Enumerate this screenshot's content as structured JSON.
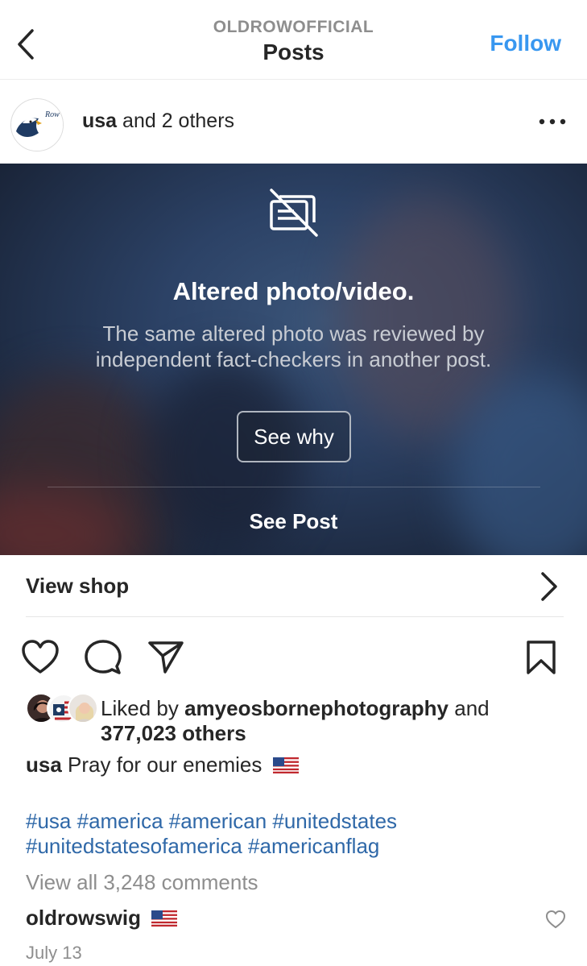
{
  "header": {
    "account": "OLDROWOFFICIAL",
    "title": "Posts",
    "follow_label": "Follow"
  },
  "post": {
    "owner_name": "usa",
    "owner_suffix": " and 2 others"
  },
  "overlay": {
    "title": "Altered photo/video.",
    "description": "The same altered photo was reviewed by independent fact-checkers in another post.",
    "see_why_label": "See why",
    "see_post_label": "See Post"
  },
  "shop": {
    "label": "View shop"
  },
  "likes": {
    "prefix": "Liked by ",
    "user": "amyeosbornephotography",
    "middle": " and ",
    "others": "377,023 others"
  },
  "caption": {
    "user": "usa",
    "text": " Pray for our enemies"
  },
  "hashtags": "#usa #america #american #unitedstates #unitedstatesofamerica #americanflag",
  "comments": {
    "view_all": "View all 3,248 comments",
    "first_user": "oldrowswig"
  },
  "date": "July 13",
  "colors": {
    "accent": "#3897f0",
    "link": "#2f68a8",
    "muted": "#8e8e8e"
  }
}
